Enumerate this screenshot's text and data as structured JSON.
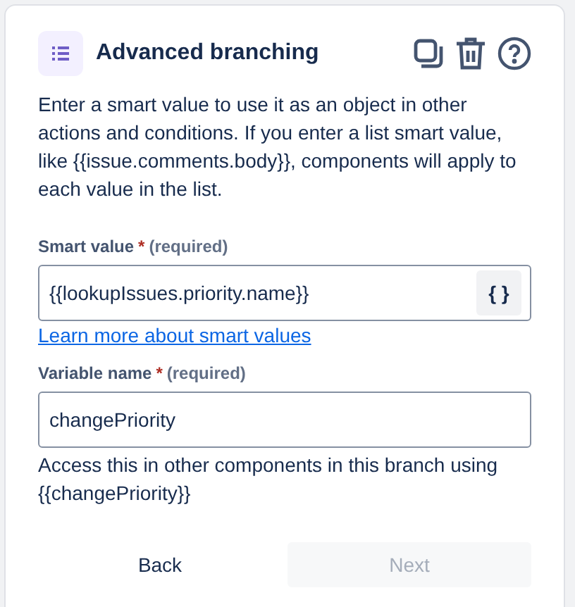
{
  "header": {
    "title": "Advanced branching"
  },
  "description": "Enter a smart value to use it as an object in other actions and conditions. If you enter a list smart value, like {{issue.comments.body}}, components will apply to each value in the list.",
  "fields": [
    {
      "label": "Smart value",
      "required_mark": "*",
      "required_note": "(required)",
      "value": "{{lookupIssues.priority.name}}",
      "button": "{ }",
      "link": "Learn more about smart values"
    },
    {
      "label": "Variable name",
      "required_mark": "*",
      "required_note": "(required)",
      "value": "changePriority",
      "helper": "Access this in other components in this branch using {{changePriority}}"
    }
  ],
  "buttons": [
    {
      "label": "Back",
      "disabled": false
    },
    {
      "label": "Next",
      "disabled": true
    }
  ]
}
